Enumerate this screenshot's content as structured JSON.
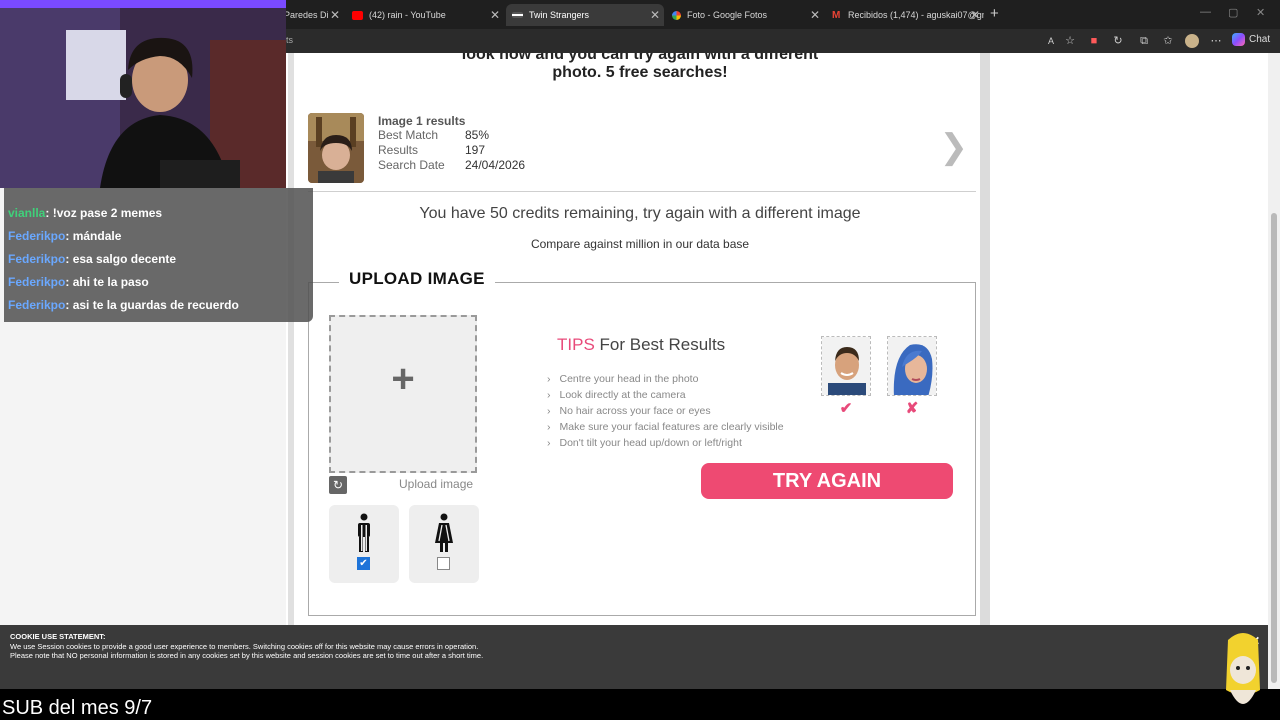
{
  "browser": {
    "tabs": [
      {
        "label": "Paredes Di",
        "active": false,
        "icon": "page-icon",
        "color": "#888888"
      },
      {
        "label": "(42) rain - YouTube",
        "active": false,
        "icon": "youtube-icon",
        "color": "#ff0000"
      },
      {
        "label": "Twin Strangers",
        "active": true,
        "icon": "twin-strangers-icon",
        "color": "#ffffff"
      },
      {
        "label": "Foto - Google Fotos",
        "active": false,
        "icon": "google-photos-icon",
        "color": "#f4b400"
      },
      {
        "label": "Recibidos (1,474) - aguskai07@gm",
        "active": false,
        "icon": "gmail-icon",
        "color": "#ea4335"
      }
    ],
    "address_fragment": "ts",
    "chat_label": "Chat"
  },
  "page": {
    "top_message_line1": "look now and you can try again with a different",
    "top_message_line2": "photo. 5 free searches!",
    "result": {
      "title": "Image 1 results",
      "best_match_label": "Best Match",
      "best_match_value": "85%",
      "results_label": "Results",
      "results_value": "197",
      "date_label": "Search Date",
      "date_value": "24/04/2026",
      "arrow": "❯"
    },
    "credits_text": "You have 50 credits remaining, try again with a different image",
    "compare_text": "Compare against million in our data base",
    "upload": {
      "legend": "UPLOAD IMAGE",
      "plus": "+",
      "upload_label": "Upload image",
      "male_checked": true,
      "female_checked": false
    },
    "tips": {
      "title_highlight": "TIPS",
      "title_rest": " For Best Results",
      "items": [
        "Centre your head in the photo",
        "Look directly at the camera",
        "No hair across your face or eyes",
        "Make sure your facial features are clearly visible",
        "Don't tilt your head up/down or left/right"
      ],
      "good_mark": "✔",
      "bad_mark": "✘"
    },
    "try_again_label": "TRY AGAIN"
  },
  "cookie": {
    "title": "COOKIE USE STATEMENT:",
    "line1": "We use Session cookies to provide a good user experience to members. Switching cookies off for this website may cause errors in operation.",
    "line2": "Please note that NO personal information is stored in any cookies set by this website and session cookies are set to time out after a short time.",
    "close": "✕"
  },
  "stream": {
    "chat": [
      {
        "user": "vianlla",
        "message": "!voz pase 2 memes",
        "color": "#3fd17a"
      },
      {
        "user": "Federikpo",
        "message": "mándale",
        "color": "#6aa8ff"
      },
      {
        "user": "Federikpo",
        "message": "esa salgo decente",
        "color": "#6aa8ff"
      },
      {
        "user": "Federikpo",
        "message": "ahi te la paso",
        "color": "#6aa8ff"
      },
      {
        "user": "Federikpo",
        "message": "asi te la guardas de recuerdo",
        "color": "#6aa8ff"
      }
    ],
    "sub_text": "SUB del mes 9/7"
  }
}
